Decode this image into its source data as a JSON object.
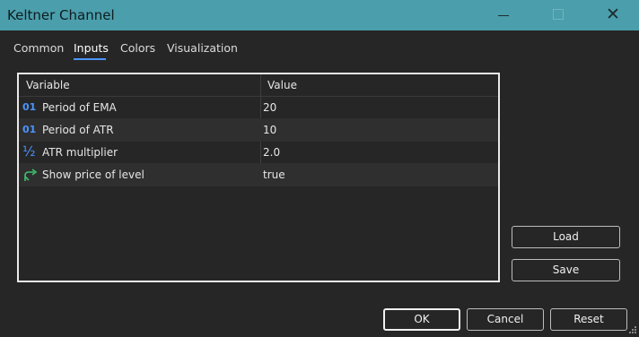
{
  "window": {
    "title": "Keltner Channel"
  },
  "tabs": [
    {
      "label": "Common"
    },
    {
      "label": "Inputs"
    },
    {
      "label": "Colors"
    },
    {
      "label": "Visualization"
    }
  ],
  "active_tab": "Inputs",
  "grid": {
    "columns": [
      "Variable",
      "Value"
    ],
    "rows": [
      {
        "icon": "integer-icon",
        "icon_text": "01",
        "variable": "Period of EMA",
        "value": "20"
      },
      {
        "icon": "integer-icon",
        "icon_text": "01",
        "variable": "Period of ATR",
        "value": "10"
      },
      {
        "icon": "fraction-icon",
        "icon_text": "½",
        "variable": "ATR multiplier",
        "value": "2.0"
      },
      {
        "icon": "boolean-icon",
        "icon_text": "",
        "variable": "Show price of level",
        "value": "true"
      }
    ]
  },
  "side_buttons": {
    "load": "Load",
    "save": "Save"
  },
  "footer_buttons": {
    "ok": "OK",
    "cancel": "Cancel",
    "reset": "Reset"
  },
  "colors": {
    "titlebar": "#4b9eab",
    "accent": "#4a95ff",
    "background": "#262626",
    "boolean_icon": "#3fbf6f"
  }
}
